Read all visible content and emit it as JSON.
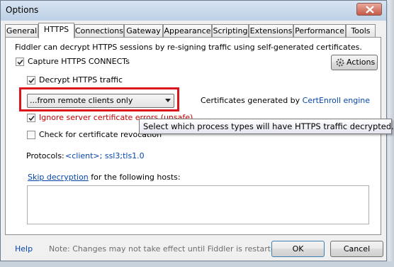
{
  "window": {
    "title": "Options"
  },
  "tabs": [
    {
      "label": "General"
    },
    {
      "label": "HTTPS"
    },
    {
      "label": "Connections"
    },
    {
      "label": "Gateway"
    },
    {
      "label": "Appearance"
    },
    {
      "label": "Scripting"
    },
    {
      "label": "Extensions"
    },
    {
      "label": "Performance"
    },
    {
      "label": "Tools"
    }
  ],
  "https": {
    "intro": "Fiddler can decrypt HTTPS sessions by re-signing traffic using self-generated certificates.",
    "capture_label": "Capture HTTPS CONNECTs",
    "capture_checked": true,
    "actions_label": "Actions",
    "decrypt_label": "Decrypt HTTPS traffic",
    "decrypt_checked": true,
    "process_filter_value": "...from remote clients only",
    "cert_prefix": "Certificates generated by ",
    "cert_link": "CertEnroll engine",
    "ignore_label": "Ignore server certificate errors (unsafe)",
    "ignore_checked": true,
    "revocation_label": "Check for certificate revocation",
    "revocation_checked": false,
    "protocols_label": "Protocols:",
    "protocols_value": "<client>; ssl3;tls1.0",
    "skip_link": "Skip decryption",
    "skip_suffix": " for the following hosts:",
    "hosts_value": ""
  },
  "tooltip": "Select which process types will have HTTPS traffic decrypted.",
  "footer": {
    "help_label": "Help",
    "note": "Note: Changes may not take effect until Fiddler is restarted.",
    "ok_label": "OK",
    "cancel_label": "Cancel"
  },
  "colors": {
    "link": "#0645ad",
    "warning_text": "#c00000",
    "highlight_border": "#d9141c"
  }
}
